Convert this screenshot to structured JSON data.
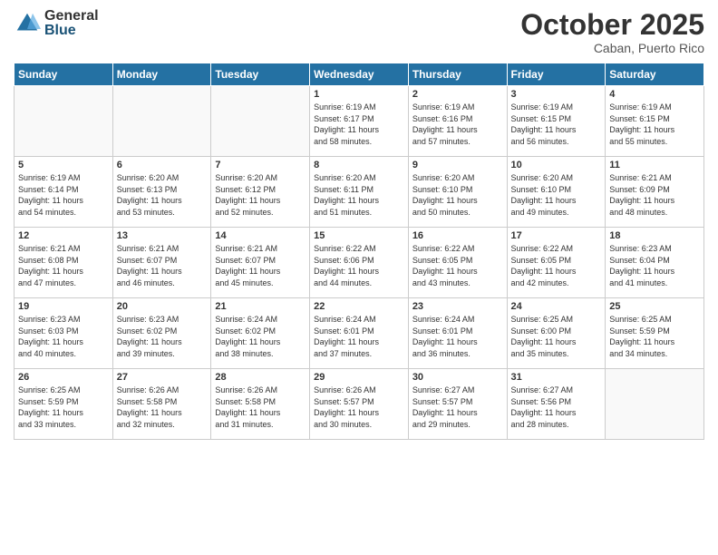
{
  "logo": {
    "general": "General",
    "blue": "Blue"
  },
  "title": "October 2025",
  "subtitle": "Caban, Puerto Rico",
  "headers": [
    "Sunday",
    "Monday",
    "Tuesday",
    "Wednesday",
    "Thursday",
    "Friday",
    "Saturday"
  ],
  "weeks": [
    [
      {
        "day": "",
        "info": ""
      },
      {
        "day": "",
        "info": ""
      },
      {
        "day": "",
        "info": ""
      },
      {
        "day": "1",
        "info": "Sunrise: 6:19 AM\nSunset: 6:17 PM\nDaylight: 11 hours\nand 58 minutes."
      },
      {
        "day": "2",
        "info": "Sunrise: 6:19 AM\nSunset: 6:16 PM\nDaylight: 11 hours\nand 57 minutes."
      },
      {
        "day": "3",
        "info": "Sunrise: 6:19 AM\nSunset: 6:15 PM\nDaylight: 11 hours\nand 56 minutes."
      },
      {
        "day": "4",
        "info": "Sunrise: 6:19 AM\nSunset: 6:15 PM\nDaylight: 11 hours\nand 55 minutes."
      }
    ],
    [
      {
        "day": "5",
        "info": "Sunrise: 6:19 AM\nSunset: 6:14 PM\nDaylight: 11 hours\nand 54 minutes."
      },
      {
        "day": "6",
        "info": "Sunrise: 6:20 AM\nSunset: 6:13 PM\nDaylight: 11 hours\nand 53 minutes."
      },
      {
        "day": "7",
        "info": "Sunrise: 6:20 AM\nSunset: 6:12 PM\nDaylight: 11 hours\nand 52 minutes."
      },
      {
        "day": "8",
        "info": "Sunrise: 6:20 AM\nSunset: 6:11 PM\nDaylight: 11 hours\nand 51 minutes."
      },
      {
        "day": "9",
        "info": "Sunrise: 6:20 AM\nSunset: 6:10 PM\nDaylight: 11 hours\nand 50 minutes."
      },
      {
        "day": "10",
        "info": "Sunrise: 6:20 AM\nSunset: 6:10 PM\nDaylight: 11 hours\nand 49 minutes."
      },
      {
        "day": "11",
        "info": "Sunrise: 6:21 AM\nSunset: 6:09 PM\nDaylight: 11 hours\nand 48 minutes."
      }
    ],
    [
      {
        "day": "12",
        "info": "Sunrise: 6:21 AM\nSunset: 6:08 PM\nDaylight: 11 hours\nand 47 minutes."
      },
      {
        "day": "13",
        "info": "Sunrise: 6:21 AM\nSunset: 6:07 PM\nDaylight: 11 hours\nand 46 minutes."
      },
      {
        "day": "14",
        "info": "Sunrise: 6:21 AM\nSunset: 6:07 PM\nDaylight: 11 hours\nand 45 minutes."
      },
      {
        "day": "15",
        "info": "Sunrise: 6:22 AM\nSunset: 6:06 PM\nDaylight: 11 hours\nand 44 minutes."
      },
      {
        "day": "16",
        "info": "Sunrise: 6:22 AM\nSunset: 6:05 PM\nDaylight: 11 hours\nand 43 minutes."
      },
      {
        "day": "17",
        "info": "Sunrise: 6:22 AM\nSunset: 6:05 PM\nDaylight: 11 hours\nand 42 minutes."
      },
      {
        "day": "18",
        "info": "Sunrise: 6:23 AM\nSunset: 6:04 PM\nDaylight: 11 hours\nand 41 minutes."
      }
    ],
    [
      {
        "day": "19",
        "info": "Sunrise: 6:23 AM\nSunset: 6:03 PM\nDaylight: 11 hours\nand 40 minutes."
      },
      {
        "day": "20",
        "info": "Sunrise: 6:23 AM\nSunset: 6:02 PM\nDaylight: 11 hours\nand 39 minutes."
      },
      {
        "day": "21",
        "info": "Sunrise: 6:24 AM\nSunset: 6:02 PM\nDaylight: 11 hours\nand 38 minutes."
      },
      {
        "day": "22",
        "info": "Sunrise: 6:24 AM\nSunset: 6:01 PM\nDaylight: 11 hours\nand 37 minutes."
      },
      {
        "day": "23",
        "info": "Sunrise: 6:24 AM\nSunset: 6:01 PM\nDaylight: 11 hours\nand 36 minutes."
      },
      {
        "day": "24",
        "info": "Sunrise: 6:25 AM\nSunset: 6:00 PM\nDaylight: 11 hours\nand 35 minutes."
      },
      {
        "day": "25",
        "info": "Sunrise: 6:25 AM\nSunset: 5:59 PM\nDaylight: 11 hours\nand 34 minutes."
      }
    ],
    [
      {
        "day": "26",
        "info": "Sunrise: 6:25 AM\nSunset: 5:59 PM\nDaylight: 11 hours\nand 33 minutes."
      },
      {
        "day": "27",
        "info": "Sunrise: 6:26 AM\nSunset: 5:58 PM\nDaylight: 11 hours\nand 32 minutes."
      },
      {
        "day": "28",
        "info": "Sunrise: 6:26 AM\nSunset: 5:58 PM\nDaylight: 11 hours\nand 31 minutes."
      },
      {
        "day": "29",
        "info": "Sunrise: 6:26 AM\nSunset: 5:57 PM\nDaylight: 11 hours\nand 30 minutes."
      },
      {
        "day": "30",
        "info": "Sunrise: 6:27 AM\nSunset: 5:57 PM\nDaylight: 11 hours\nand 29 minutes."
      },
      {
        "day": "31",
        "info": "Sunrise: 6:27 AM\nSunset: 5:56 PM\nDaylight: 11 hours\nand 28 minutes."
      },
      {
        "day": "",
        "info": ""
      }
    ]
  ]
}
